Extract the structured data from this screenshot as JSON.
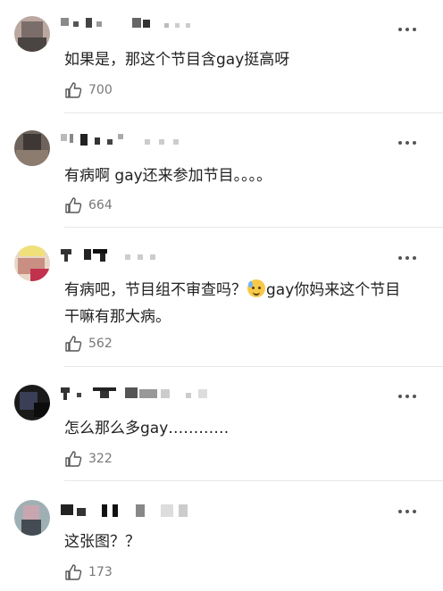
{
  "comments": [
    {
      "text": "如果是，那这个节目含gay挺高呀",
      "likes": "700"
    },
    {
      "text": "有病啊 gay还来参加节目。。。。",
      "likes": "664"
    },
    {
      "text_before": "有病吧，节目组不审查吗？",
      "text_emoji": "sweat-smile-emoji",
      "text_after": "gay你妈来这个节目干嘛有那大病。",
      "likes": "562"
    },
    {
      "text": "怎么那么多gay…………",
      "likes": "322"
    },
    {
      "text": "这张图？？",
      "likes": "173"
    }
  ],
  "icons": {
    "like": "thumbs-up-icon",
    "more": "more-dots-icon"
  },
  "colors": {
    "text": "#222222",
    "meta": "#777777",
    "separator": "#e6e6e6"
  }
}
